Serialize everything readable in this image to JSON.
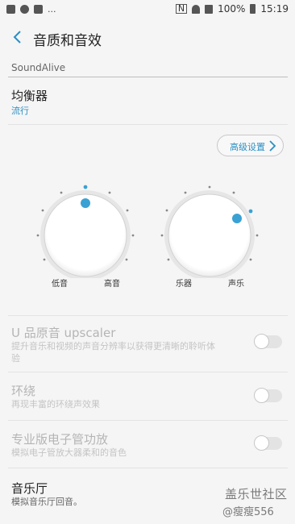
{
  "status_bar": {
    "left_text": "...",
    "battery": "100%",
    "time": "15:19",
    "nfc": "N"
  },
  "header": {
    "back_icon": "chevron-left",
    "title": "音质和音效"
  },
  "section": {
    "label": "SoundAlive"
  },
  "equalizer": {
    "title": "均衡器",
    "value": "流行",
    "advanced_label": "高级设置"
  },
  "knobs": [
    {
      "left_label": "低音",
      "right_label": "高音"
    },
    {
      "left_label": "乐器",
      "right_label": "声乐"
    }
  ],
  "settings": [
    {
      "title": "U 品原音 upscaler",
      "subtitle": "提升音乐和视频的声音分辨率以获得更清晰的聆听体验",
      "enabled": false,
      "on": false
    },
    {
      "title": "环绕",
      "subtitle": "再现丰富的环绕声效果",
      "enabled": false,
      "on": false
    },
    {
      "title": "专业版电子管功放",
      "subtitle": "模拟电子管放大器柔和的音色",
      "enabled": false,
      "on": false
    },
    {
      "title": "音乐厅",
      "subtitle": "模拟音乐厅回音。",
      "enabled": true
    }
  ],
  "watermark": {
    "line1": "盖乐世社区",
    "line2": "@瘦瘦556"
  },
  "colors": {
    "accent": "#2a8fc4",
    "knob_dot": "#3aa1d4",
    "disabled_text": "#b5b5b5"
  }
}
